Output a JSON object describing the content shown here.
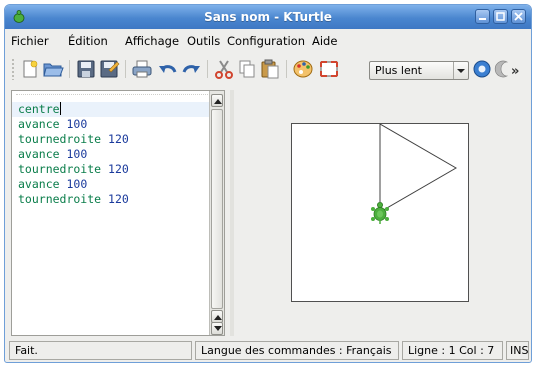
{
  "window": {
    "title": "Sans nom - KTurtle"
  },
  "menu": {
    "items": [
      "Fichier",
      "Édition",
      "Affichage",
      "Outils",
      "Configuration",
      "Aide"
    ]
  },
  "toolbar": {
    "icons": [
      "new-file-icon",
      "open-folder-icon",
      "save-icon",
      "save-as-icon",
      "print-icon",
      "undo-icon",
      "redo-icon",
      "cut-icon",
      "copy-icon",
      "paste-icon",
      "palette-icon",
      "fullscreen-icon",
      "run-icon",
      "pause-icon",
      "more-chevron-icon"
    ],
    "speed_selected": "Plus lent",
    "more_label": "»"
  },
  "editor": {
    "lines": [
      {
        "cmd": "centre",
        "arg": ""
      },
      {
        "cmd": "avance",
        "arg": "100"
      },
      {
        "cmd": "tournedroite",
        "arg": "120"
      },
      {
        "cmd": "avance",
        "arg": "100"
      },
      {
        "cmd": "tournedroite",
        "arg": "120"
      },
      {
        "cmd": "avance",
        "arg": "100"
      },
      {
        "cmd": "tournedroite",
        "arg": "120"
      }
    ]
  },
  "status": {
    "message": "Fait.",
    "language": "Langue des commandes : Français",
    "position": "Ligne : 1 Col : 7",
    "mode": "INS"
  },
  "colors": {
    "command": "#0a7d4a",
    "number": "#1a3a9c",
    "turtle": "#3f9a2e",
    "titlebar": "#4a86cf"
  }
}
